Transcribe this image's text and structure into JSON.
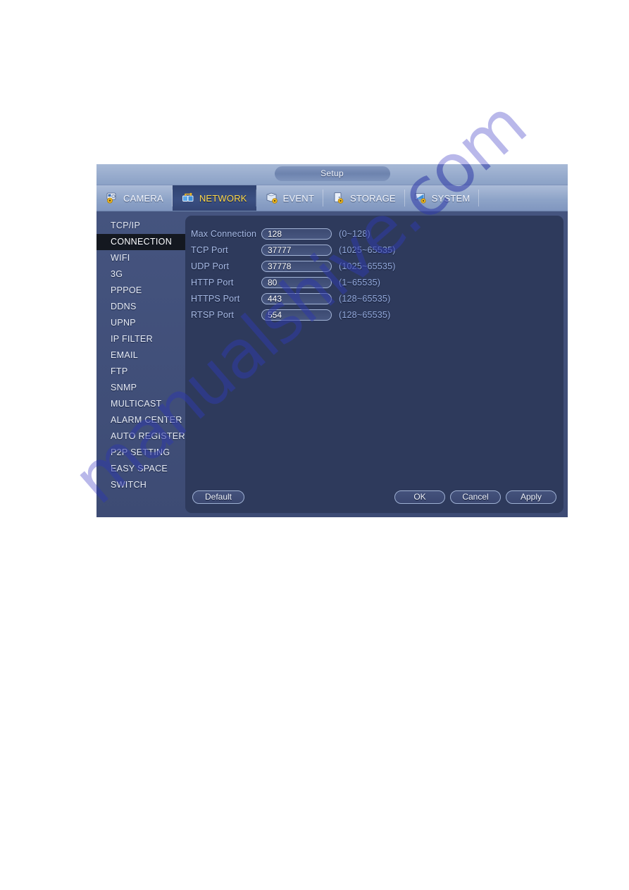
{
  "watermark": {
    "text": "manualshive.com"
  },
  "dialog": {
    "title": "Setup",
    "tabs": [
      {
        "label": "CAMERA",
        "icon": "camera-gear-icon",
        "active": false
      },
      {
        "label": "NETWORK",
        "icon": "network-icon",
        "active": true
      },
      {
        "label": "EVENT",
        "icon": "event-gear-icon",
        "active": false
      },
      {
        "label": "STORAGE",
        "icon": "storage-gear-icon",
        "active": false
      },
      {
        "label": "SYSTEM",
        "icon": "system-gear-icon",
        "active": false
      }
    ],
    "sidebar": {
      "items": [
        {
          "label": "TCP/IP",
          "selected": false
        },
        {
          "label": "CONNECTION",
          "selected": true
        },
        {
          "label": "WIFI",
          "selected": false
        },
        {
          "label": "3G",
          "selected": false
        },
        {
          "label": "PPPOE",
          "selected": false
        },
        {
          "label": "DDNS",
          "selected": false
        },
        {
          "label": "UPNP",
          "selected": false
        },
        {
          "label": "IP FILTER",
          "selected": false
        },
        {
          "label": "EMAIL",
          "selected": false
        },
        {
          "label": "FTP",
          "selected": false
        },
        {
          "label": "SNMP",
          "selected": false
        },
        {
          "label": "MULTICAST",
          "selected": false
        },
        {
          "label": "ALARM CENTER",
          "selected": false
        },
        {
          "label": "AUTO REGISTER",
          "selected": false
        },
        {
          "label": "P2P SETTING",
          "selected": false
        },
        {
          "label": "EASY SPACE",
          "selected": false
        },
        {
          "label": "SWITCH",
          "selected": false
        }
      ]
    },
    "form": {
      "rows": [
        {
          "label": "Max Connection",
          "value": "128",
          "hint": "(0~128)"
        },
        {
          "label": "TCP Port",
          "value": "37777",
          "hint": "(1025~65535)"
        },
        {
          "label": "UDP Port",
          "value": "37778",
          "hint": "(1025~65535)"
        },
        {
          "label": "HTTP Port",
          "value": "80",
          "hint": "(1~65535)"
        },
        {
          "label": "HTTPS Port",
          "value": "443",
          "hint": "(128~65535)"
        },
        {
          "label": "RTSP Port",
          "value": "554",
          "hint": "(128~65535)"
        }
      ]
    },
    "buttons": {
      "default_label": "Default",
      "ok_label": "OK",
      "cancel_label": "Cancel",
      "apply_label": "Apply"
    }
  },
  "colors": {
    "dialog_chrome": "#8fa5c9",
    "panel_bg": "#2e3a5c",
    "sidebar_bg": "#42507a",
    "active_tab_text": "#ffd94a",
    "label_text": "#a8bbe6",
    "selected_item_bg": "#141820",
    "watermark": "#b9b8ea"
  }
}
